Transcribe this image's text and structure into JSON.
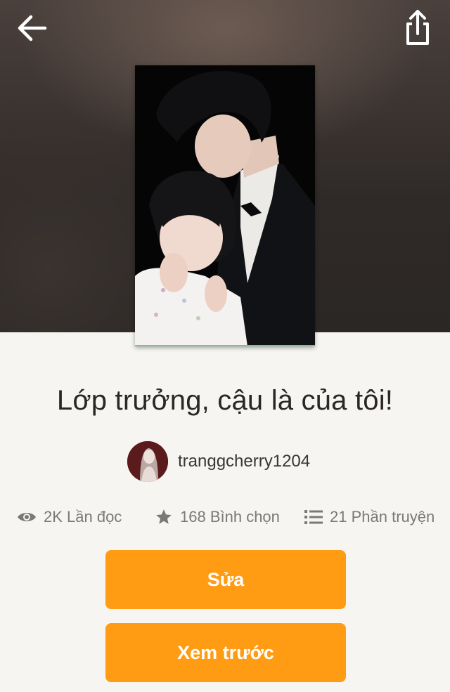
{
  "header": {
    "back_icon": "arrow-left-icon",
    "share_icon": "share-icon"
  },
  "story": {
    "title": "Lớp trưởng, cậu là của tôi!",
    "author": "tranggcherry1204"
  },
  "stats": {
    "reads": "2K Lần đọc",
    "votes": "168 Bình chọn",
    "parts": "21 Phần truyện"
  },
  "actions": {
    "edit_label": "Sửa",
    "preview_label": "Xem trước"
  },
  "colors": {
    "accent": "#ff9c14",
    "background": "#f6f5f1",
    "text": "#2b2726",
    "muted": "#7b7876"
  }
}
